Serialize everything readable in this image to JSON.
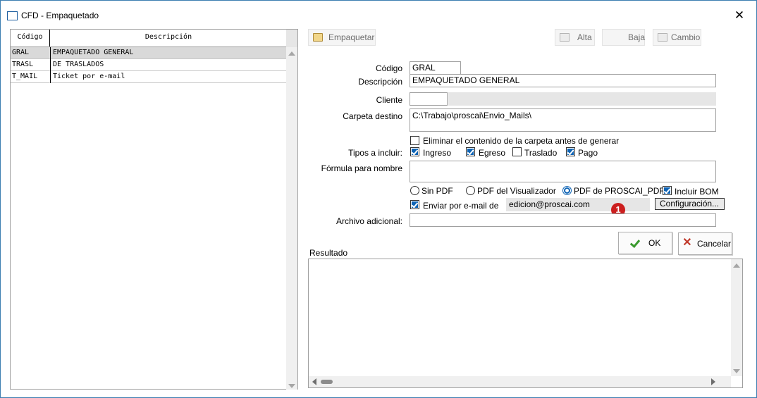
{
  "window": {
    "title": "CFD - Empaquetado",
    "close_glyph": "✕"
  },
  "list": {
    "headers": {
      "code": "Código",
      "description": "Descripción"
    },
    "rows": [
      {
        "code": "GRAL",
        "description": "EMPAQUETADO GENERAL",
        "selected": true
      },
      {
        "code": "TRASL",
        "description": "DE TRASLADOS",
        "selected": false
      },
      {
        "code": "T_MAIL",
        "description": "Ticket por e-mail",
        "selected": false
      }
    ]
  },
  "toolbar": {
    "empaquetar": "Empaquetar",
    "alta": "Alta",
    "baja": "Baja",
    "cambio": "Cambio"
  },
  "form": {
    "codigo_label": "Código",
    "codigo_value": "GRAL",
    "descripcion_label": "Descripción",
    "descripcion_value": "EMPAQUETADO GENERAL",
    "cliente_label": "Cliente",
    "cliente_value": "",
    "carpeta_label": "Carpeta destino",
    "carpeta_value": "C:\\Trabajo\\proscai\\Envio_Mails\\",
    "eliminar_label": "Eliminar el contenido de la carpeta antes de generar",
    "eliminar_checked": false,
    "tipos_label": "Tipos a incluir:",
    "tipos": [
      {
        "label": "Ingreso",
        "checked": true
      },
      {
        "label": "Egreso",
        "checked": true
      },
      {
        "label": "Traslado",
        "checked": false
      },
      {
        "label": "Pago",
        "checked": true
      }
    ],
    "formula_label": "Fórmula para nombre",
    "formula_value": "",
    "pdf_options": [
      {
        "label": "Sin PDF",
        "selected": false
      },
      {
        "label": "PDF del Visualizador",
        "selected": false
      },
      {
        "label": "PDF de PROSCAI_PDF",
        "selected": true
      }
    ],
    "incluir_bom_label": "Incluir BOM",
    "incluir_bom_checked": true,
    "enviar_label": "Enviar por e-mail de",
    "enviar_checked": true,
    "email_value": "edicion@proscai.com",
    "badge": "1",
    "configuracion_label": "Configuración...",
    "archivo_label": "Archivo adicional:",
    "archivo_value": ""
  },
  "actions": {
    "ok": "OK",
    "cancelar": "Cancelar"
  },
  "result": {
    "label": "Resultado"
  },
  "colors": {
    "accent": "#0d63b5",
    "badge": "#cc1f1f",
    "ok_check": "#3a9a2e",
    "cancel_x": "#c0392b"
  }
}
